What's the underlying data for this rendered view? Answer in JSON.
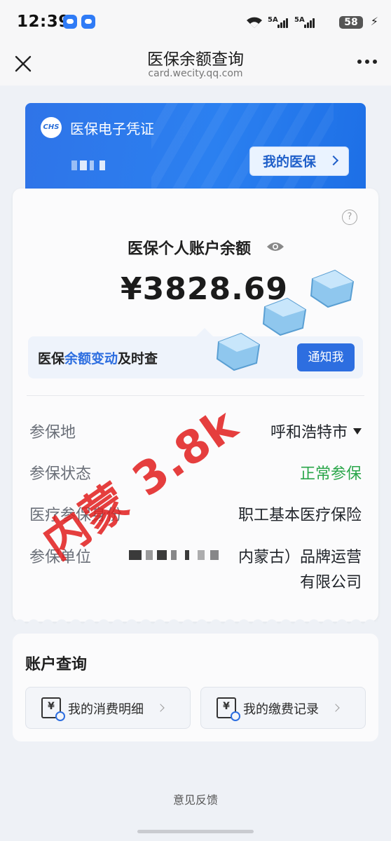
{
  "status_bar": {
    "time": "12:39",
    "network_1": "5A",
    "network_2": "5A",
    "battery": "58"
  },
  "nav": {
    "title": "医保余额查询",
    "subtitle": "card.wecity.qq.com"
  },
  "banner": {
    "logo_text": "CHS",
    "title": "医保电子凭证",
    "my_insurance_label": "我的医保"
  },
  "balance": {
    "label": "医保个人账户余额",
    "amount": "¥3828.69"
  },
  "notify": {
    "text_before": "医保",
    "text_highlight": "余额变动",
    "text_after": "及时查",
    "button_label": "通知我"
  },
  "info": {
    "place_label": "参保地",
    "place_value": "呼和浩特市",
    "status_label": "参保状态",
    "status_value": "正常参保",
    "identity_label": "医疗参保身份",
    "identity_value": "职工基本医疗保险",
    "employer_label": "参保单位",
    "employer_line1": "内蒙古）品牌运营",
    "employer_line2": "有限公司"
  },
  "account_query": {
    "title": "账户查询",
    "consumption_label": "我的消费明细",
    "payment_label": "我的缴费记录",
    "icon_symbol": "¥"
  },
  "feedback": "意见反馈",
  "watermark": "内蒙 3.8k",
  "colors": {
    "primary_blue": "#2d6ee0",
    "status_green": "#2aa64a",
    "watermark_red": "#e11e1e"
  }
}
